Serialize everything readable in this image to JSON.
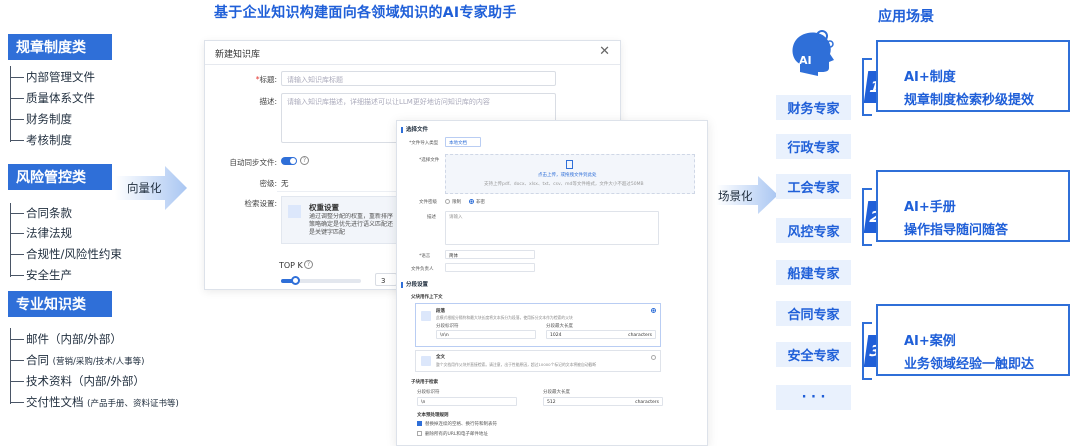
{
  "title": "基于企业知识构建面向各领域知识的AI专家助手",
  "scenes_title": "应用场景",
  "categories": [
    {
      "name": "规章制度类",
      "items": [
        "内部管理文件",
        "质量体系文件",
        "财务制度",
        "考核制度"
      ]
    },
    {
      "name": "风险管控类",
      "items": [
        "合同条款",
        "法律法规",
        "合规性/风险性约束",
        "安全生产"
      ]
    },
    {
      "name": "专业知识类",
      "items": [
        "邮件（内部/外部）",
        "合同",
        "技术资料（内部/外部）",
        "交付性文档"
      ],
      "notes": [
        "",
        "(营销/采购/技术/人事等)",
        "",
        "(产品手册、资料证书等)"
      ]
    }
  ],
  "arrow_vectorize": "向量化",
  "arrow_scene": "场景化",
  "dialog": {
    "title": "新建知识库",
    "close": "✕",
    "name_label": "标题:",
    "name_placeholder": "请输入知识库标题",
    "desc_label": "描述:",
    "desc_placeholder": "请输入知识库描述，详细描述可以让LLM更好地访问知识库的内容",
    "sync_label": "自动同步文件:",
    "level_label": "密级:",
    "level_value": "无",
    "retrieval_label": "检索设置:",
    "retrieval_title": "权重设置",
    "retrieval_desc": "通过调整分配的权重，重新排序策略确定是优先进行语义匹配还是关键字匹配",
    "topk_label": "TOP K",
    "topk_value": "3"
  },
  "panel": {
    "sec_select": "选择文件",
    "import_type_label": "*文件导入类型",
    "import_type_value": "本地文档",
    "select_file_label": "*选择文件",
    "upload_main": "点击上传，或拖拽文件到此处",
    "upload_hint": "支持上传pdf、docx、xlsx、txt、csv、md等文件格式，文件大小不超过50MB",
    "file_level_label": "文件密级",
    "file_level_options": [
      "限制",
      "非密"
    ],
    "desc_label": "描述",
    "desc_placeholder": "请输入",
    "lang_label": "*语言",
    "lang_value": "简体",
    "owner_label": "文件负责人",
    "sec_chunk": "分段设置",
    "parent_child": "父块用作上下文",
    "para_title": "段落",
    "para_desc": "此模式根据分隔符和最大块长度将文本拆分为段落，使用拆分文本作为检索的父块",
    "sep_label": "分段标识符",
    "sep_value": "\\n\\n",
    "maxlen_label": "分段最大长度",
    "maxlen_value": "1024",
    "unit": "characters",
    "full_title": "全文",
    "full_desc": "整个文档用作父块并直接检索。请注意，出于性能原因，超过10000个标记的文本将被自动截断",
    "child_label": "子块用于检索",
    "child_sep_label": "分段标识符",
    "child_sep_value": "\\n",
    "child_max_label": "分段最大长度",
    "child_max_value": "512",
    "rules_label": "文本预处理规则",
    "rule1": "替换掉连续的空格、换行符和制表符",
    "rule2": "删除所有的URL和电子邮件地址"
  },
  "ai_icon_label": "AI",
  "experts": [
    "财务专家",
    "行政专家",
    "工会专家",
    "风控专家",
    "船建专家",
    "合同专家",
    "安全专家",
    "· · ·"
  ],
  "scenes": [
    {
      "num": "1",
      "line1": "AI+制度",
      "line2": "规章制度检索秒级提效"
    },
    {
      "num": "2",
      "line1": "AI+手册",
      "line2": "操作指导随问随答"
    },
    {
      "num": "3",
      "line1": "AI+案例",
      "line2": "业务领域经验一触即达"
    }
  ],
  "colors": {
    "accent": "#2f6fd8",
    "accent_dark": "#1f5fd8",
    "expert_bg": "#e9f1fd",
    "arrow": "#a9c6f2"
  }
}
